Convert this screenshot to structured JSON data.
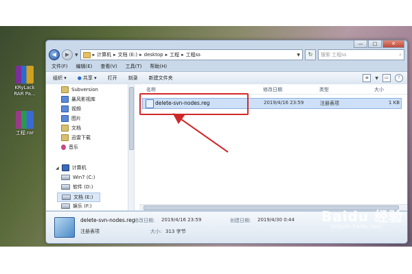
{
  "desktop": {
    "icons": [
      {
        "label_line1": "KRyLack",
        "label_line2": "RAR Pa..."
      },
      {
        "label_line1": "工程.rar",
        "label_line2": ""
      }
    ]
  },
  "window": {
    "controls": {
      "minimize": "—",
      "maximize": "□",
      "close": "✕"
    },
    "breadcrumb": [
      "计算机",
      "文档 (E:)",
      "desktop",
      "工程",
      "工程ss"
    ],
    "search_placeholder": "搜索 工程ss",
    "menu": [
      "文件(F)",
      "编辑(E)",
      "查看(V)",
      "工具(T)",
      "帮助(H)"
    ],
    "toolbar": [
      "组织 ▾",
      "打开",
      "刻录",
      "新建文件夹"
    ],
    "toolbar_share": "共享 ▾",
    "nav": {
      "favorites": [
        "Subversion",
        "暴风影视库",
        "视频",
        "图片",
        "文档",
        "迅雷下载",
        "音乐"
      ],
      "computer_label": "计算机",
      "drives": [
        "Win7 (C:)",
        "软件 (D:)",
        "文档 (E:)",
        "娱乐 (F:)"
      ]
    },
    "columns": [
      "名称",
      "修改日期",
      "类型",
      "大小"
    ],
    "file": {
      "name": "delete-svn-nodes.reg",
      "modified": "2019/4/16 23:59",
      "type": "注册表项",
      "size": "1 KB"
    },
    "details": {
      "name": "delete-svn-nodes.reg",
      "type": "注册表项",
      "modified_label": "修改日期:",
      "modified": "2019/4/16 23:59",
      "created_label": "创建日期:",
      "created": "2019/4/30 0:44",
      "size_label": "大小:",
      "size": "313 字节"
    }
  },
  "watermark": {
    "brand": "Baidu 经验",
    "url": "jingyan.baidu.com"
  },
  "colors": {
    "highlight_box": "#d02828",
    "selection": "#cde0f7"
  }
}
